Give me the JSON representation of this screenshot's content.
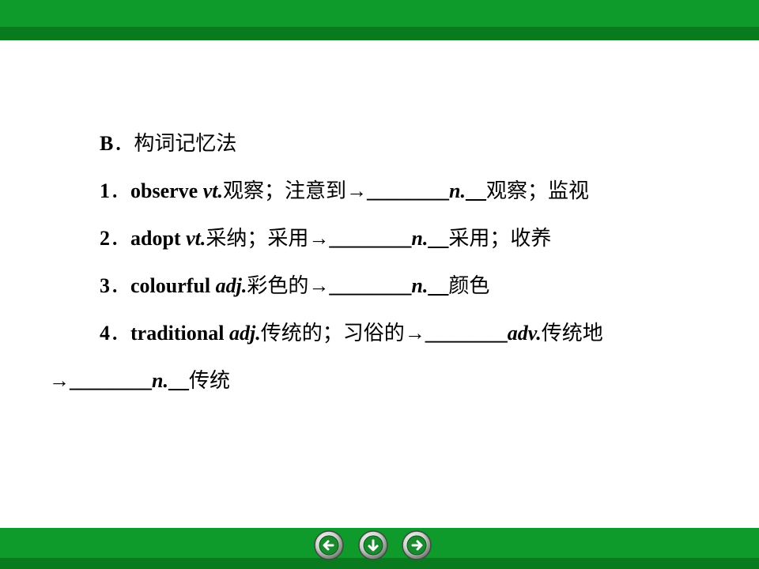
{
  "colors": {
    "bar_green": "#0f9a2c",
    "bar_dark_green": "#0a7a1f",
    "button_green": "#1a8a2e"
  },
  "heading": {
    "letter": "B",
    "sep": "．",
    "text": "构词记忆法"
  },
  "items": [
    {
      "num": "1",
      "sep": "．",
      "word": "observe",
      "pos": "vt.",
      "meaning": "观察；注意到",
      "arrow": "→",
      "blank": "________",
      "ans_pos": "n.",
      "ans_pad": "__",
      "ans_meaning": "观察；监视"
    },
    {
      "num": "2",
      "sep": "．",
      "word": "adopt",
      "pos": "vt.",
      "meaning": "采纳；采用",
      "arrow": "→",
      "blank": "________",
      "ans_pos": "n.",
      "ans_pad": "__",
      "ans_meaning": "采用；收养"
    },
    {
      "num": "3",
      "sep": "．",
      "word": "colourful",
      "pos": "adj.",
      "meaning": "彩色的",
      "arrow": "→",
      "blank": "________",
      "ans_pos": "n.",
      "ans_pad": "__",
      "ans_meaning": "颜色"
    },
    {
      "num": "4",
      "sep": "．",
      "word": "traditional",
      "pos": "adj.",
      "meaning": "传统的；习俗的",
      "arrow": "→",
      "blank": "________",
      "ans_pos": "adv.",
      "ans_meaning": "传统地",
      "cont_arrow": "→",
      "cont_blank": "________",
      "cont_pos": "n.",
      "cont_pad": "__",
      "cont_meaning": "传统"
    }
  ],
  "nav": {
    "prev_icon": "arrow-left-icon",
    "home_icon": "arrow-down-icon",
    "next_icon": "arrow-right-icon"
  }
}
